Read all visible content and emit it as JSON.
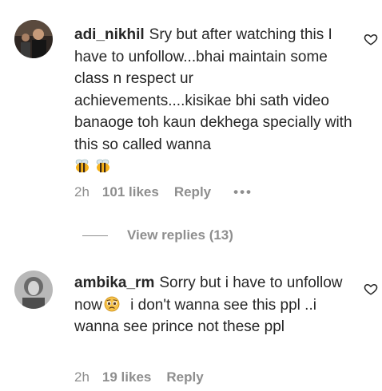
{
  "comments": [
    {
      "username": "adi_nikhil",
      "text": "Sry but after watching this I have to unfollow...bhai maintain some class n respect ur achievements....kisikae bhi sath video banaoge toh kaun dekhega specially with this so called wanna",
      "emojis": [
        "bee-emoji",
        "bee-emoji"
      ],
      "time": "2h",
      "likes": "101 likes",
      "reply_label": "Reply",
      "more_label": "•••",
      "view_replies": "View replies (13)"
    },
    {
      "username": "ambika_rm",
      "text_before_emoji": "Sorry but i have to unfollow now",
      "emoji": "pleading-face-emoji",
      "text_after_emoji": " i don't wanna see this ppl ..i wanna see prince not these ppl",
      "time": "2h",
      "likes": "19 likes",
      "reply_label": "Reply"
    }
  ],
  "icons": {
    "like": "heart-outline-icon"
  },
  "colors": {
    "text": "#262626",
    "secondary": "#8e8e8e",
    "bee_yellow": "#f5b21b",
    "sad_face": "#f6c24a"
  }
}
